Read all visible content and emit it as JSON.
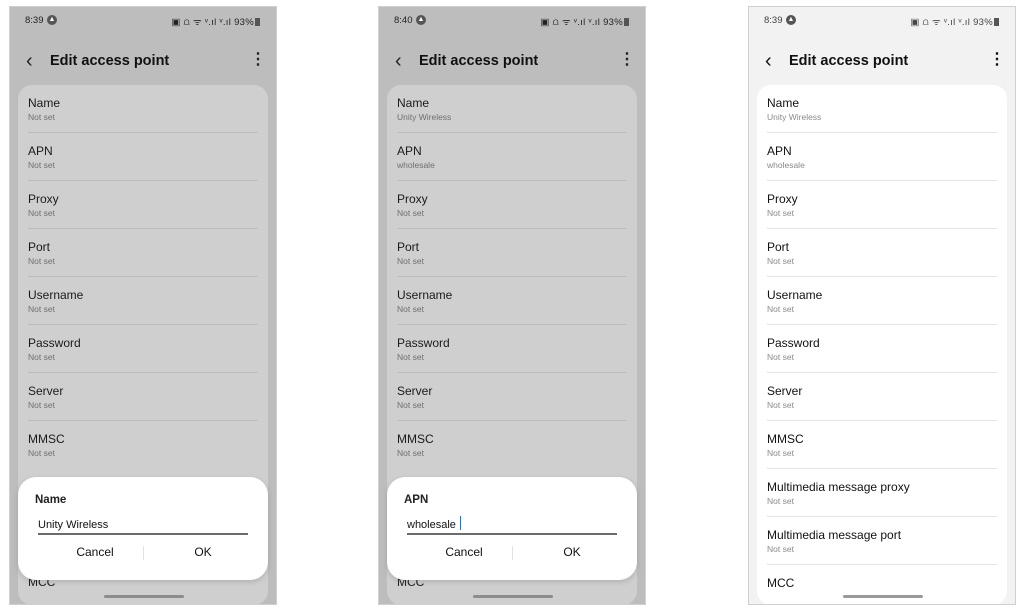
{
  "screens": [
    {
      "status": {
        "time": "8:39",
        "right": "▣ ⩍ ᯤ ᵛ.ıl ᵛ.ıl 93%"
      },
      "title": "Edit access point",
      "items": [
        {
          "label": "Name",
          "value": "Not set"
        },
        {
          "label": "APN",
          "value": "Not set"
        },
        {
          "label": "Proxy",
          "value": "Not set"
        },
        {
          "label": "Port",
          "value": "Not set"
        },
        {
          "label": "Username",
          "value": "Not set"
        },
        {
          "label": "Password",
          "value": "Not set"
        },
        {
          "label": "Server",
          "value": "Not set"
        },
        {
          "label": "MMSC",
          "value": "Not set"
        }
      ],
      "dialog": {
        "title": "Name",
        "input_value": "Unity Wireless",
        "cancel": "Cancel",
        "ok": "OK"
      },
      "peek_label": "MCC"
    },
    {
      "status": {
        "time": "8:40",
        "right": "▣ ⩍ ᯤ ᵛ.ıl ᵛ.ıl 93%"
      },
      "title": "Edit access point",
      "items": [
        {
          "label": "Name",
          "value": "Unity Wireless"
        },
        {
          "label": "APN",
          "value": "wholesale"
        },
        {
          "label": "Proxy",
          "value": "Not set"
        },
        {
          "label": "Port",
          "value": "Not set"
        },
        {
          "label": "Username",
          "value": "Not set"
        },
        {
          "label": "Password",
          "value": "Not set"
        },
        {
          "label": "Server",
          "value": "Not set"
        },
        {
          "label": "MMSC",
          "value": "Not set"
        }
      ],
      "dialog": {
        "title": "APN",
        "input_value": "wholesale",
        "cancel": "Cancel",
        "ok": "OK"
      },
      "peek_label": "MCC"
    },
    {
      "status": {
        "time": "8:39",
        "right": "▣ ⩍ ᯤ ᵛ.ıl ᵛ.ıl 93%"
      },
      "title": "Edit access point",
      "items": [
        {
          "label": "Name",
          "value": "Unity Wireless"
        },
        {
          "label": "APN",
          "value": "wholesale"
        },
        {
          "label": "Proxy",
          "value": "Not set"
        },
        {
          "label": "Port",
          "value": "Not set"
        },
        {
          "label": "Username",
          "value": "Not set"
        },
        {
          "label": "Password",
          "value": "Not set"
        },
        {
          "label": "Server",
          "value": "Not set"
        },
        {
          "label": "MMSC",
          "value": "Not set"
        },
        {
          "label": "Multimedia message proxy",
          "value": "Not set"
        },
        {
          "label": "Multimedia message port",
          "value": "Not set"
        },
        {
          "label": "MCC",
          "value": ""
        }
      ]
    }
  ],
  "colors": {
    "dim_background": "#bdbdbd",
    "dim_card": "#cfcfcf",
    "card": "#ffffff",
    "caret": "#2d6cdf"
  },
  "icons": {
    "back": "chevron-left-icon",
    "more": "more-vertical-icon"
  }
}
